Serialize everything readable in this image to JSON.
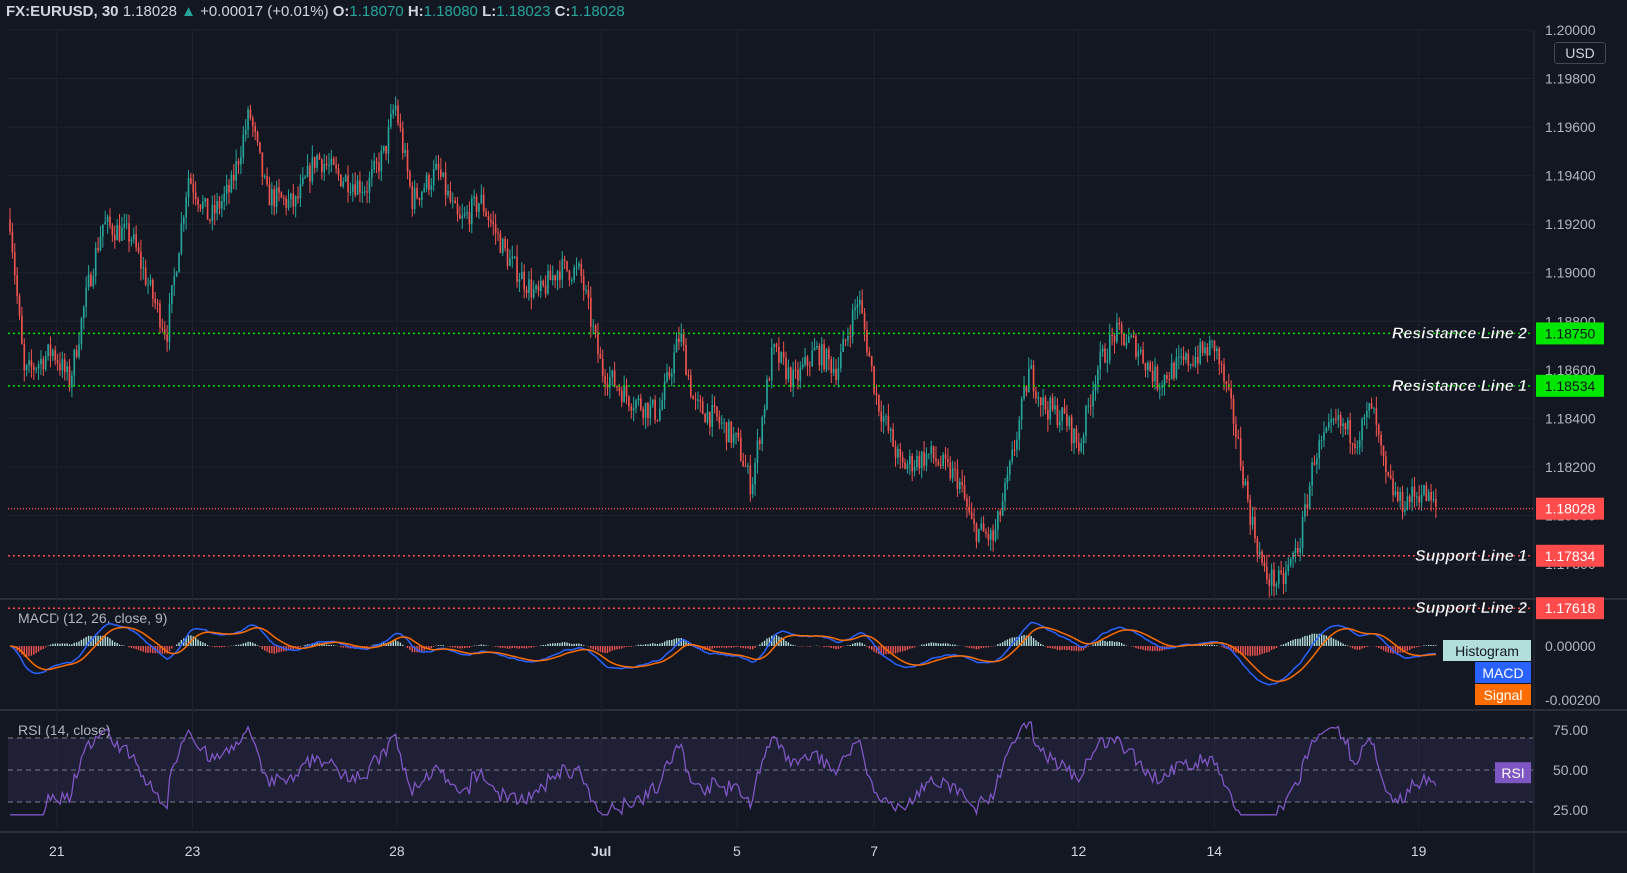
{
  "header": {
    "symbol": "FX:EURUSD, 30",
    "last": "1.18028",
    "change": "+0.00017 (+0.01%)",
    "o_label": "O:",
    "o": "1.18070",
    "h_label": "H:",
    "h": "1.18080",
    "l_label": "L:",
    "l": "1.18023",
    "c_label": "C:",
    "c": "1.18028"
  },
  "currency": "USD",
  "colors": {
    "background": "#131722",
    "up": "#26a69a",
    "down": "#ef5350",
    "resistance": "#00e600",
    "support": "#ff4b4b",
    "macd": "#2962ff",
    "signal": "#ff6d00",
    "rsi": "#7e57c2",
    "histogram_label": "#b2dfdb"
  },
  "chart_data": {
    "type": "candlestick",
    "symbol": "EURUSD",
    "timeframe": "30",
    "ylim": [
      1.1766,
      1.2
    ],
    "price_ticks": [
      "1.20000",
      "1.19800",
      "1.19600",
      "1.19400",
      "1.19200",
      "1.19000",
      "1.18800",
      "1.18600",
      "1.18400",
      "1.18200",
      "1.18000",
      "1.17800"
    ],
    "x_ticks": [
      "21",
      "23",
      "28",
      "Jul",
      "5",
      "7",
      "12",
      "14",
      "19"
    ],
    "close_path_anchors": [
      {
        "x": 0.0,
        "y": 1.1922
      },
      {
        "x": 0.01,
        "y": 1.1858
      },
      {
        "x": 0.03,
        "y": 1.1868
      },
      {
        "x": 0.042,
        "y": 1.1855
      },
      {
        "x": 0.055,
        "y": 1.1895
      },
      {
        "x": 0.065,
        "y": 1.192
      },
      {
        "x": 0.085,
        "y": 1.1915
      },
      {
        "x": 0.1,
        "y": 1.189
      },
      {
        "x": 0.11,
        "y": 1.1875
      },
      {
        "x": 0.125,
        "y": 1.194
      },
      {
        "x": 0.14,
        "y": 1.1922
      },
      {
        "x": 0.155,
        "y": 1.1935
      },
      {
        "x": 0.168,
        "y": 1.1966
      },
      {
        "x": 0.18,
        "y": 1.1932
      },
      {
        "x": 0.2,
        "y": 1.1928
      },
      {
        "x": 0.215,
        "y": 1.1948
      },
      {
        "x": 0.23,
        "y": 1.194
      },
      {
        "x": 0.25,
        "y": 1.1935
      },
      {
        "x": 0.263,
        "y": 1.195
      },
      {
        "x": 0.27,
        "y": 1.197
      },
      {
        "x": 0.282,
        "y": 1.193
      },
      {
        "x": 0.3,
        "y": 1.1942
      },
      {
        "x": 0.315,
        "y": 1.192
      },
      {
        "x": 0.33,
        "y": 1.193
      },
      {
        "x": 0.35,
        "y": 1.1905
      },
      {
        "x": 0.37,
        "y": 1.189
      },
      {
        "x": 0.385,
        "y": 1.1902
      },
      {
        "x": 0.4,
        "y": 1.19
      },
      {
        "x": 0.415,
        "y": 1.186
      },
      {
        "x": 0.435,
        "y": 1.1848
      },
      {
        "x": 0.455,
        "y": 1.1842
      },
      {
        "x": 0.47,
        "y": 1.1875
      },
      {
        "x": 0.48,
        "y": 1.1845
      },
      {
        "x": 0.495,
        "y": 1.184
      },
      {
        "x": 0.51,
        "y": 1.183
      },
      {
        "x": 0.52,
        "y": 1.1812
      },
      {
        "x": 0.535,
        "y": 1.1868
      },
      {
        "x": 0.55,
        "y": 1.1855
      },
      {
        "x": 0.565,
        "y": 1.1868
      },
      {
        "x": 0.58,
        "y": 1.186
      },
      {
        "x": 0.595,
        "y": 1.189
      },
      {
        "x": 0.608,
        "y": 1.1848
      },
      {
        "x": 0.625,
        "y": 1.182
      },
      {
        "x": 0.645,
        "y": 1.1825
      },
      {
        "x": 0.665,
        "y": 1.1815
      },
      {
        "x": 0.675,
        "y": 1.1795
      },
      {
        "x": 0.69,
        "y": 1.179
      },
      {
        "x": 0.7,
        "y": 1.1815
      },
      {
        "x": 0.715,
        "y": 1.186
      },
      {
        "x": 0.725,
        "y": 1.1845
      },
      {
        "x": 0.74,
        "y": 1.184
      },
      {
        "x": 0.75,
        "y": 1.1828
      },
      {
        "x": 0.762,
        "y": 1.186
      },
      {
        "x": 0.775,
        "y": 1.1875
      },
      {
        "x": 0.79,
        "y": 1.187
      },
      {
        "x": 0.805,
        "y": 1.1855
      },
      {
        "x": 0.815,
        "y": 1.186
      },
      {
        "x": 0.83,
        "y": 1.1865
      },
      {
        "x": 0.845,
        "y": 1.187
      },
      {
        "x": 0.858,
        "y": 1.184
      },
      {
        "x": 0.87,
        "y": 1.18
      },
      {
        "x": 0.88,
        "y": 1.1775
      },
      {
        "x": 0.892,
        "y": 1.1772
      },
      {
        "x": 0.905,
        "y": 1.179
      },
      {
        "x": 0.915,
        "y": 1.1825
      },
      {
        "x": 0.93,
        "y": 1.1838
      },
      {
        "x": 0.945,
        "y": 1.1832
      },
      {
        "x": 0.955,
        "y": 1.1845
      },
      {
        "x": 0.965,
        "y": 1.1815
      },
      {
        "x": 0.975,
        "y": 1.1805
      },
      {
        "x": 0.99,
        "y": 1.181
      },
      {
        "x": 1.0,
        "y": 1.1803
      }
    ],
    "levels": [
      {
        "name": "Resistance Line 2",
        "price": "1.18750",
        "value": 1.1875,
        "kind": "resistance"
      },
      {
        "name": "Resistance Line 1",
        "price": "1.18534",
        "value": 1.18534,
        "kind": "resistance"
      },
      {
        "name": "",
        "price": "1.18028",
        "value": 1.18028,
        "kind": "last"
      },
      {
        "name": "Support Line 1",
        "price": "1.17834",
        "value": 1.17834,
        "kind": "support"
      },
      {
        "name": "Support Line 2",
        "price": "1.17618",
        "value": 1.17618,
        "kind": "support"
      }
    ],
    "macd": {
      "label": "MACD (12, 26, close, 9)",
      "ticks": [
        "0.00000",
        "-0.00200"
      ],
      "legend": [
        "Histogram",
        "MACD",
        "Signal"
      ]
    },
    "rsi": {
      "label": "RSI (14, close)",
      "ticks": [
        "75.00",
        "50.00",
        "25.00"
      ],
      "band": [
        30,
        70
      ],
      "legend": "RSI",
      "last": 48
    }
  }
}
